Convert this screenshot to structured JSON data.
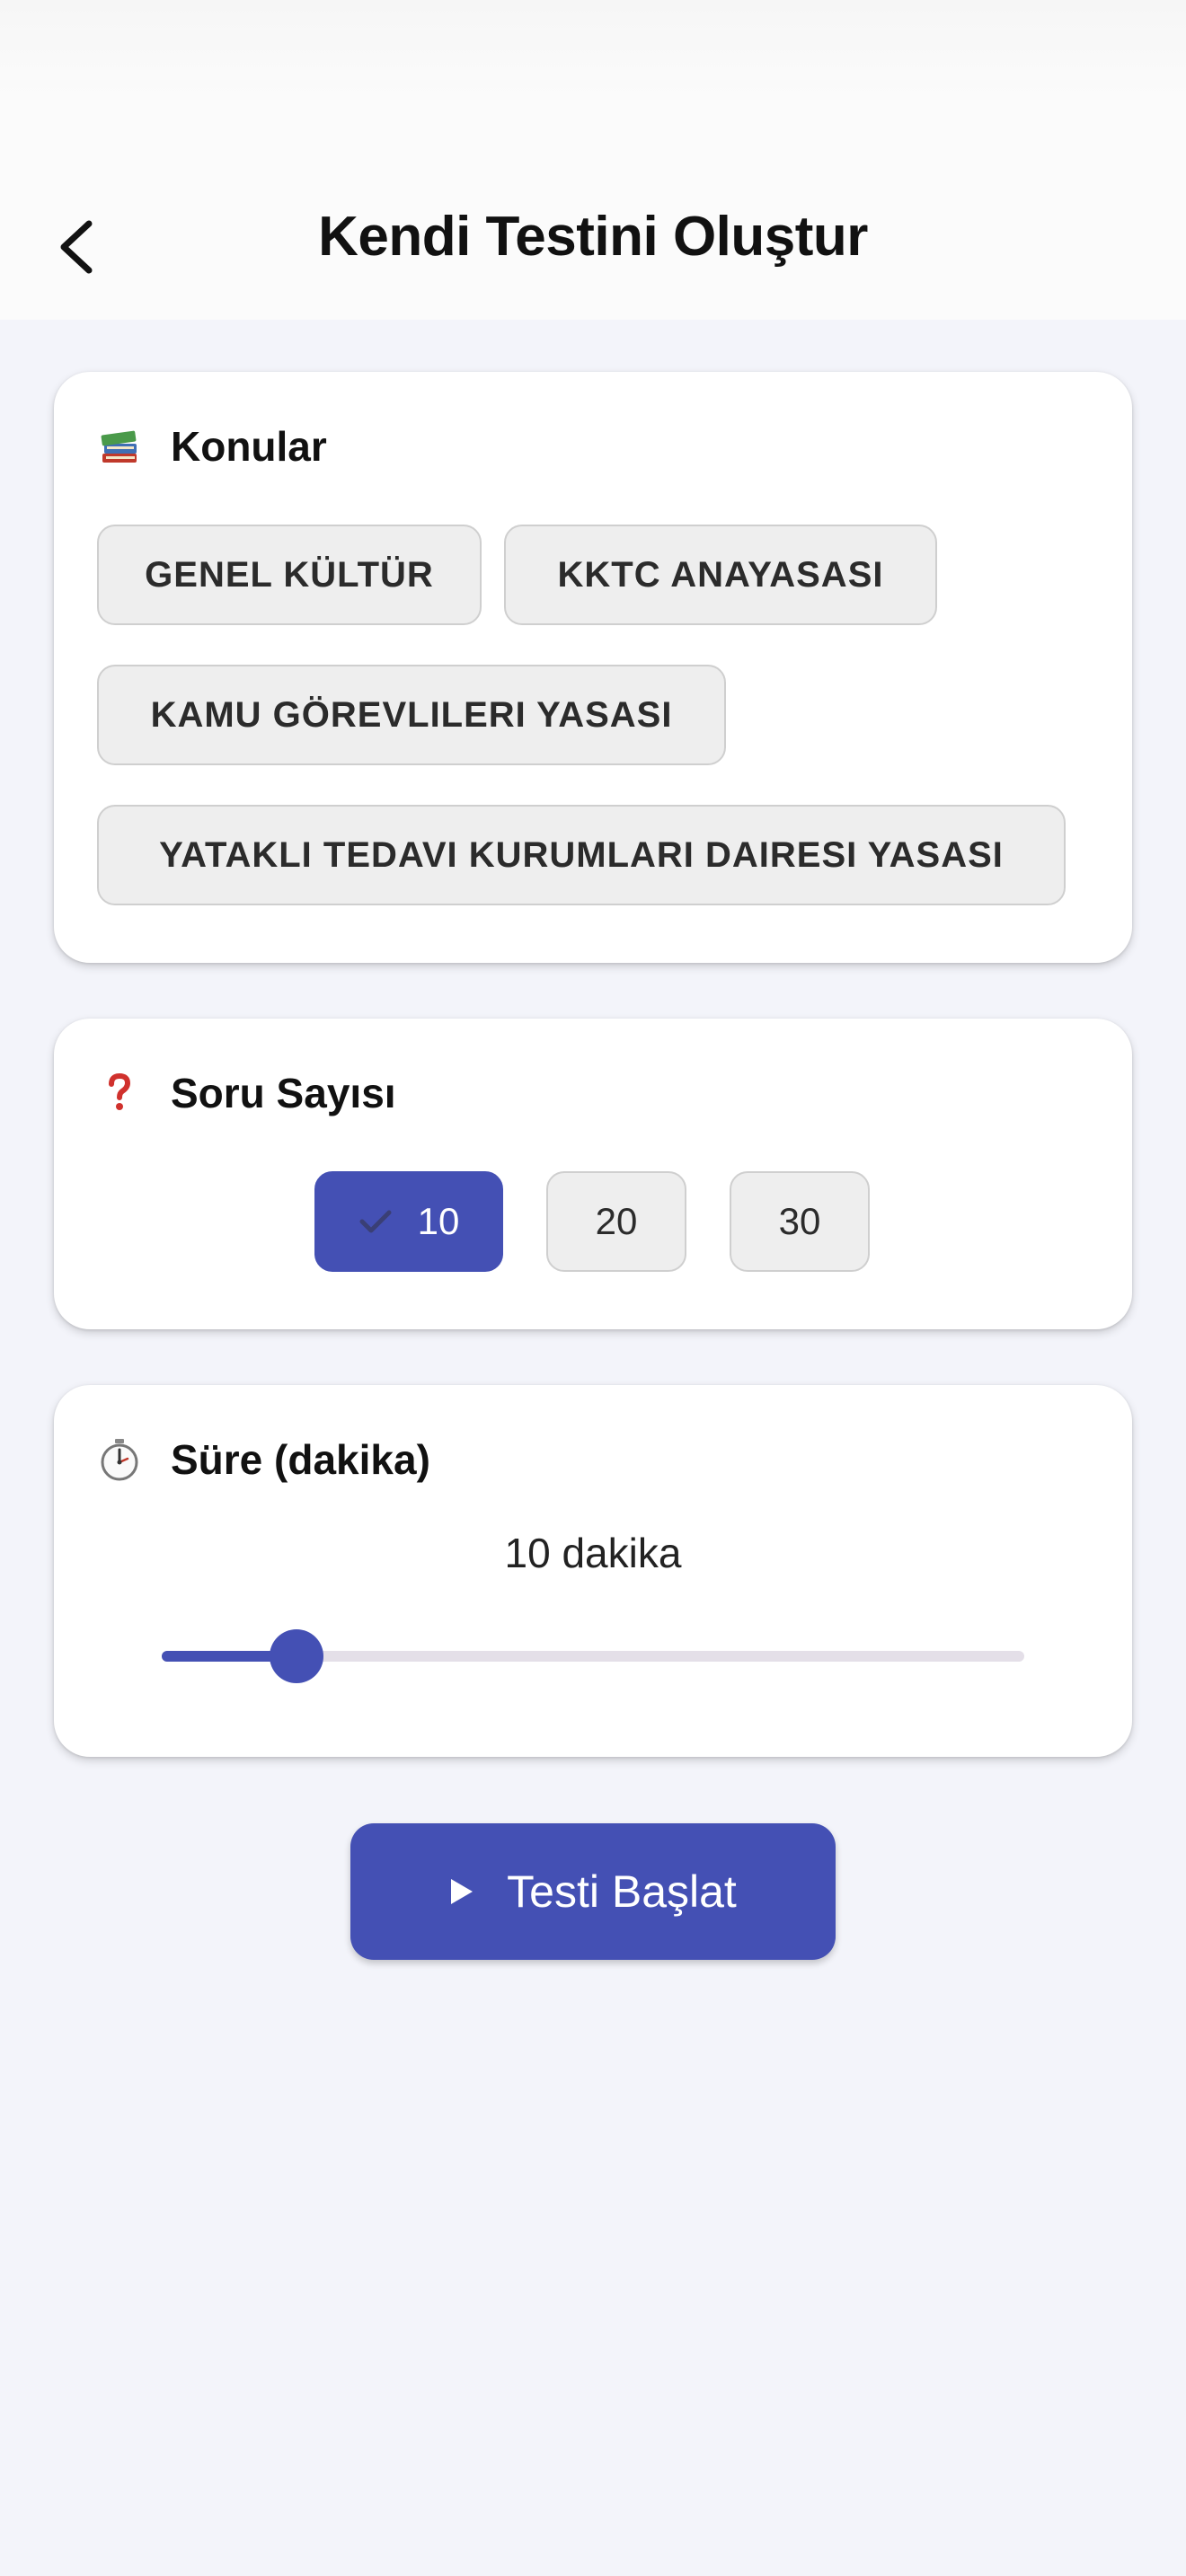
{
  "header": {
    "title": "Kendi Testini Oluştur"
  },
  "topics": {
    "title": "Konular",
    "icon": "books-icon",
    "chips": [
      "GENEL KÜLTÜR",
      "KKTC ANAYASASI",
      "KAMU GÖREVLILERI YASASI",
      "YATAKLI TEDAVI KURUMLARI DAIRESI YASASI"
    ]
  },
  "question_count": {
    "title": "Soru Sayısı",
    "icon": "question-mark-icon",
    "options": [
      "10",
      "20",
      "30"
    ],
    "selected": "10"
  },
  "duration": {
    "title": "Süre (dakika)",
    "icon": "stopwatch-icon",
    "value_label": "10 dakika",
    "slider_fraction": 0.156
  },
  "start_button": {
    "label": "Testi Başlat"
  },
  "colors": {
    "accent": "#4450b4",
    "chip_bg": "#eeeeee",
    "page_bg": "#f3f4fa"
  }
}
